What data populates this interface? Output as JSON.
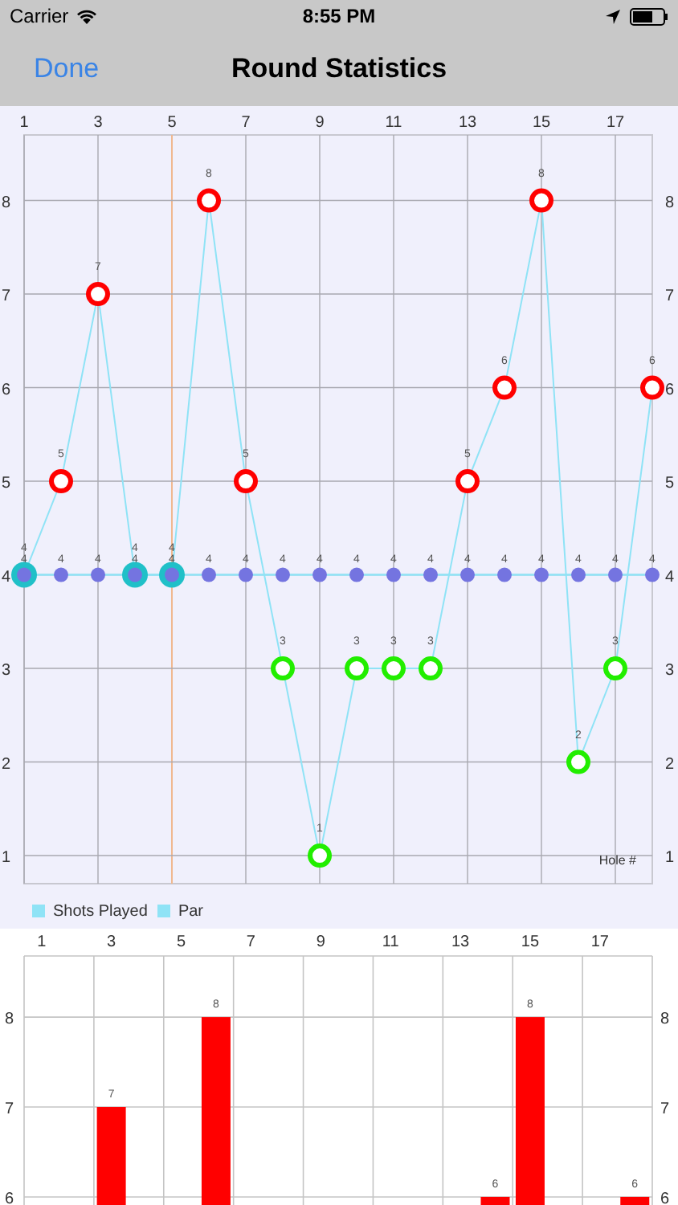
{
  "status_bar": {
    "carrier": "Carrier",
    "time": "8:55 PM"
  },
  "nav_bar": {
    "back_button": "Done",
    "title": "Round Statistics"
  },
  "line_chart": {
    "chart_data": {
      "type": "line",
      "xlabel": "Hole #",
      "x": [
        1,
        2,
        3,
        4,
        5,
        6,
        7,
        8,
        9,
        10,
        11,
        12,
        13,
        14,
        15,
        16,
        17,
        18
      ],
      "series": [
        {
          "name": "Shots Played",
          "color": "#8fe3f6",
          "marker": "o",
          "values": [
            4,
            5,
            7,
            4,
            4,
            8,
            5,
            3,
            1,
            3,
            3,
            3,
            5,
            6,
            8,
            2,
            3,
            6
          ]
        },
        {
          "name": "Par",
          "color": "#8fe3f6",
          "marker": "o",
          "values": [
            4,
            4,
            4,
            4,
            4,
            4,
            4,
            4,
            4,
            4,
            4,
            4,
            4,
            4,
            4,
            4,
            4,
            4
          ]
        }
      ],
      "xlim": [
        1,
        18
      ],
      "ylim": [
        0.7,
        8.7
      ],
      "xticks": [
        1,
        3,
        5,
        7,
        9,
        11,
        13,
        15,
        17
      ],
      "yticks": [
        1,
        2,
        3,
        4,
        5,
        6,
        7,
        8
      ],
      "y2ticks": [
        1,
        2,
        3,
        4,
        5,
        6,
        7,
        8
      ],
      "y2lim": [
        0.7,
        8.7
      ],
      "grid": true,
      "data_labels": true,
      "ref_lines": [
        {
          "axis": "x",
          "value": 5,
          "color": "#f0b890"
        }
      ]
    }
  },
  "bar_chart": {
    "chart_data": {
      "type": "bar",
      "x": [
        3,
        6,
        14,
        15,
        18
      ],
      "series": [
        {
          "color": "#ff0000",
          "values": [
            7,
            8,
            6,
            8,
            6
          ]
        }
      ],
      "xlim": [
        0.5,
        18.5
      ],
      "ylim": [
        5.91,
        8.68
      ],
      "xticks": [
        1,
        3,
        5,
        7,
        9,
        11,
        13,
        15,
        17
      ],
      "yticks": [
        6,
        7,
        8
      ],
      "y2ticks": [
        6,
        7,
        8
      ],
      "y2lim": [
        5.91,
        8.68
      ],
      "grid": true,
      "data_labels": true
    }
  }
}
